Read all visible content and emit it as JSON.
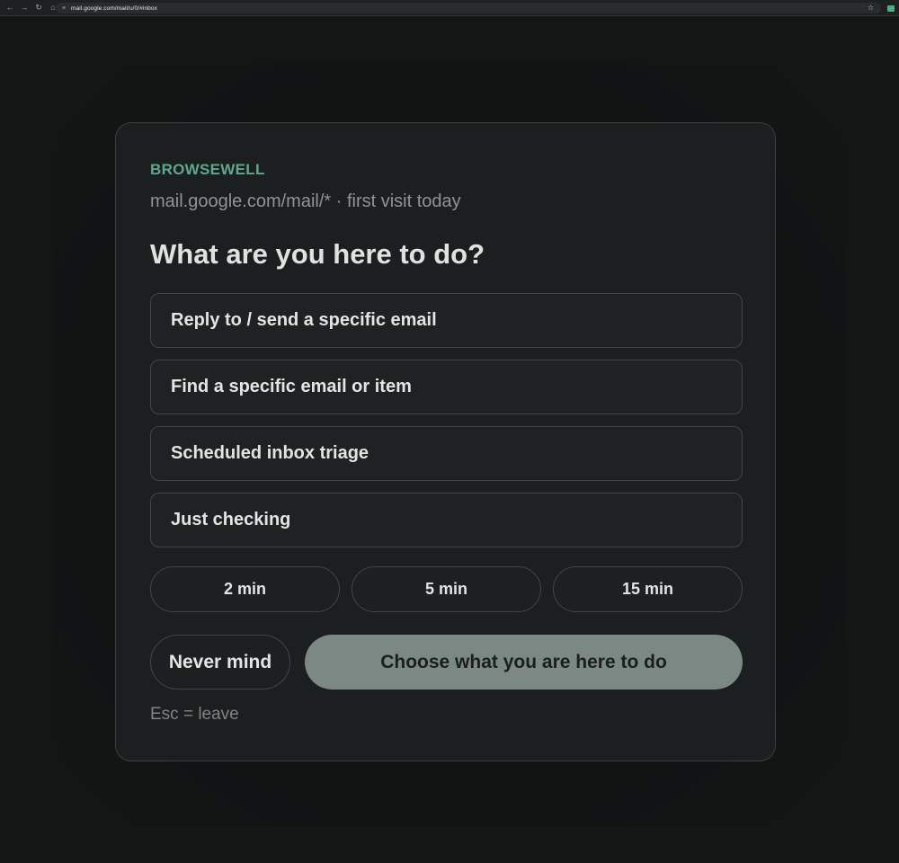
{
  "browser": {
    "url": "mail.google.com/mail/u/0/#inbox",
    "back_icon": "arrow-left-icon",
    "forward_icon": "arrow-right-icon",
    "reload_icon": "reload-icon",
    "home_icon": "home-icon"
  },
  "card": {
    "brand": "BROWSEWELL",
    "subtitle": "mail.google.com/mail/* · first visit today",
    "question": "What are you here to do?",
    "options": [
      "Reply to / send a specific email",
      "Find a specific email or item",
      "Scheduled inbox triage",
      "Just checking"
    ],
    "durations": [
      "2 min",
      "5 min",
      "15 min"
    ],
    "never_mind": "Never mind",
    "choose": "Choose what you are here to do",
    "hint": "Esc = leave"
  },
  "colors": {
    "background": "#121615",
    "card": "#1c1f1f",
    "brand": "#5fa88c",
    "primary_button": "#7c8884"
  }
}
